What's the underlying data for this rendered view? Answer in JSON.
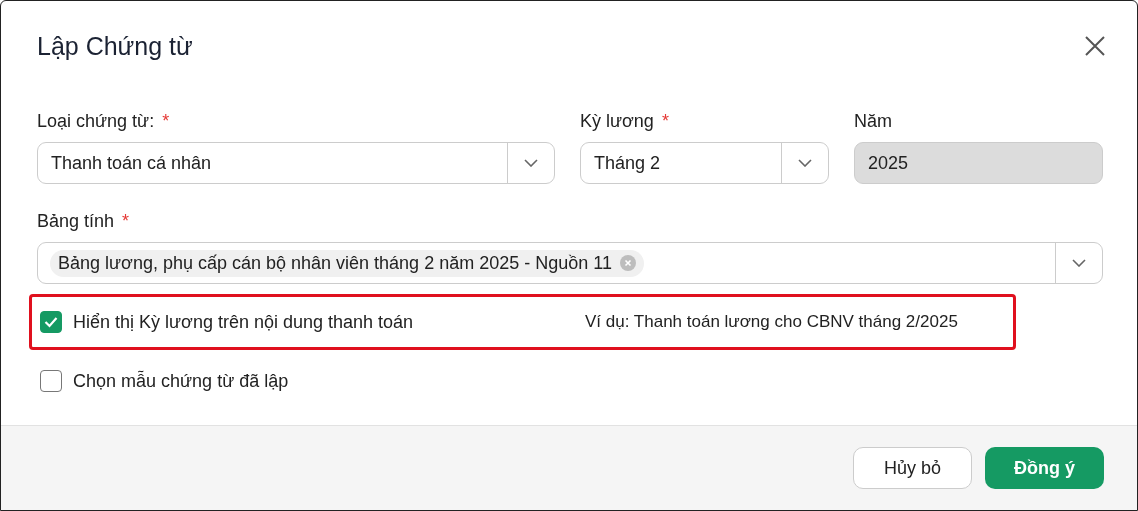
{
  "dialog": {
    "title": "Lập Chứng từ"
  },
  "fields": [
    {
      "label": "Loại chứng từ:",
      "required_mark": "*",
      "value": "Thanh toán cá nhân",
      "kind": "select",
      "disabled": false
    },
    {
      "label": "Kỳ lương",
      "required_mark": "*",
      "value": "Tháng 2",
      "kind": "select",
      "disabled": false
    },
    {
      "label": "Năm",
      "value": "2025",
      "kind": "text",
      "disabled": true
    }
  ],
  "worksheet": {
    "label": "Bảng tính",
    "required_mark": "*",
    "tags": [
      "Bảng lương, phụ cấp cán bộ nhân viên tháng 2 năm 2025 - Nguồn 11"
    ]
  },
  "options": [
    {
      "label": "Hiển thị Kỳ lương trên nội dung thanh toán",
      "checked": true,
      "highlighted": true,
      "example": "Ví dụ: Thanh toán lương cho CBNV tháng 2/2025"
    },
    {
      "label": "Chọn mẫu chứng từ đã lập",
      "checked": false,
      "highlighted": false
    }
  ],
  "buttons": [
    {
      "label": "Hủy bỏ",
      "kind": "secondary"
    },
    {
      "label": "Đồng ý",
      "kind": "primary"
    }
  ]
}
